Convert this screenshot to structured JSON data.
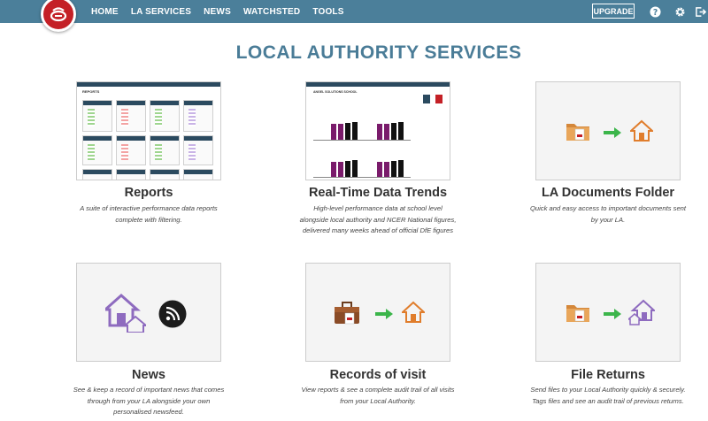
{
  "nav": {
    "items": [
      {
        "label": "HOME"
      },
      {
        "label": "LA SERVICES"
      },
      {
        "label": "NEWS"
      },
      {
        "label": "WATCHSTED"
      },
      {
        "label": "TOOLS"
      }
    ],
    "upgrade_label": "UPGRADE"
  },
  "page": {
    "title": "LOCAL AUTHORITY SERVICES"
  },
  "cards": [
    {
      "title": "Reports",
      "description": "A suite of interactive performance data reports complete with filtering."
    },
    {
      "title": "Real-Time Data Trends",
      "description": "High-level performance data at school level alongside local authority and NCER National figures, delivered many weeks ahead of official DfE figures"
    },
    {
      "title": "LA Documents Folder",
      "description": "Quick and easy access to important documents sent by your LA."
    },
    {
      "title": "News",
      "description": "See & keep a record of important news that comes through from your LA alongside your own personalised newsfeed."
    },
    {
      "title": "Records of visit",
      "description": "View reports & see a complete audit trail of all visits from your Local Authority."
    },
    {
      "title": "File Returns",
      "description": "Send files to your Local Authority quickly & securely. Tags files and see an audit trail of previous returns."
    }
  ],
  "thumbnails": {
    "reports_screen_title": "REPORTS",
    "trends_screen_title": "ANGEL SOLUTIONS SCHOOL"
  },
  "colors": {
    "topbar": "#4b7f9a",
    "title": "#4a7c97",
    "logo": "#c42026"
  },
  "icons": [
    "help-icon",
    "gear-icon",
    "logout-icon",
    "folder-icon",
    "arrow-right-icon",
    "house-icon",
    "rss-icon",
    "briefcase-icon"
  ]
}
